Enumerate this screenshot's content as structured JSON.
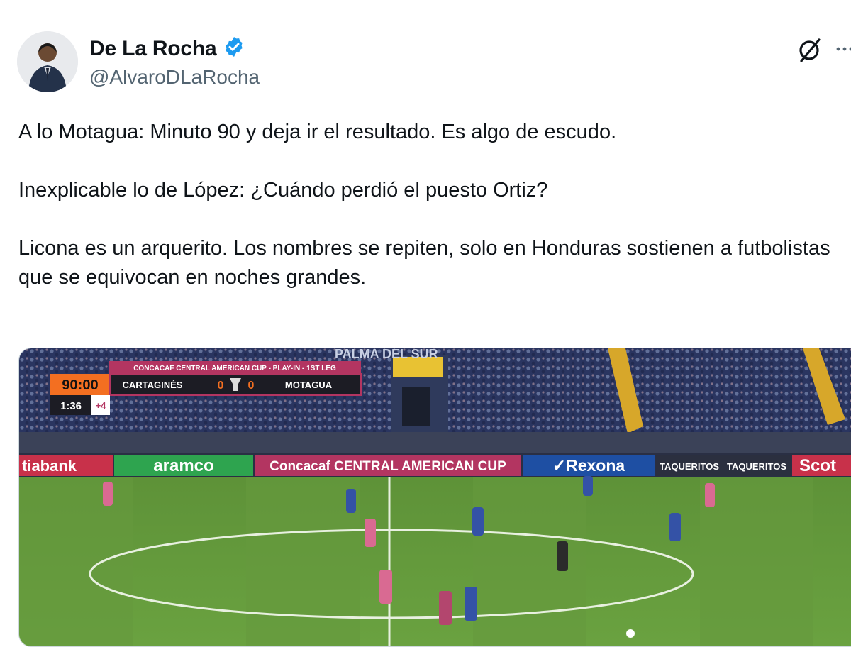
{
  "author": {
    "display_name": "De La Rocha",
    "handle": "@AlvaroDLaRocha",
    "verified": true
  },
  "tweet": {
    "paragraphs": [
      "A lo Motagua: Minuto 90 y deja ir el resultado. Es algo de escudo.",
      "Inexplicable lo de López: ¿Cuándo perdió el puesto Ortiz?",
      "Licona es un arquerito. Los nombres se repiten, solo en Honduras sostienen a futbolistas que se equivocan en noches grandes."
    ]
  },
  "media": {
    "scoreboard": {
      "competition": "CONCACAF CENTRAL AMERICAN CUP - PLAY-IN - 1ST LEG",
      "clock": "90:00",
      "home_team": "CARTAGINÉS",
      "home_score": "0",
      "away_score": "0",
      "away_team": "MOTAGUA",
      "added_time_clock": "1:36",
      "added_minutes": "+4"
    },
    "stadium_banner": "PALMA DEL SUR",
    "ad_boards": [
      "tiabank",
      "aramco",
      "Concacaf CENTRAL AMERICAN CUP",
      "✓Rexona",
      "TAQUERITOS",
      "TAQUERITOS",
      "Scot"
    ]
  },
  "icons": [
    "verified-badge-icon",
    "grok-icon",
    "more-icon"
  ],
  "colors": {
    "verified": "#1d9bf0",
    "handle": "#536471",
    "pitch": "#5d8f3a",
    "scoreboard_clock": "#f36f21"
  }
}
